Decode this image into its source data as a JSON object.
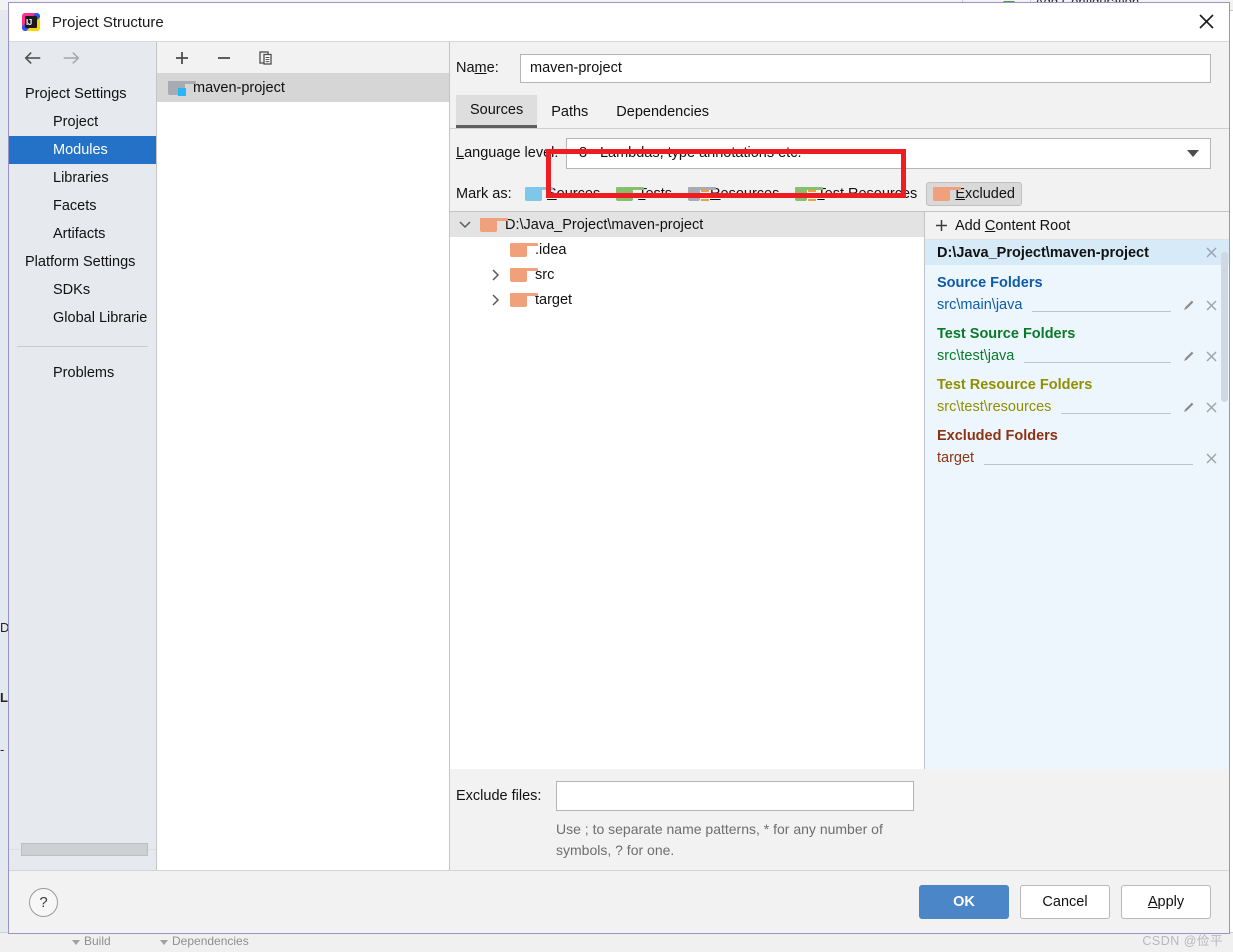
{
  "background": {
    "add_configuration": "Add Configuration...",
    "left_fragments": [
      "D",
      "L",
      "-"
    ],
    "bottom_items": [
      "Build",
      "Dependencies"
    ]
  },
  "window": {
    "title": "Project Structure",
    "app_icon": "intellij-idea-icon",
    "close_icon": "close-icon"
  },
  "sidebar": {
    "back_icon": "arrow-left-icon",
    "forward_icon": "arrow-right-icon",
    "items": [
      {
        "label": "Project Settings",
        "type": "group"
      },
      {
        "label": "Project",
        "type": "child"
      },
      {
        "label": "Modules",
        "type": "child",
        "selected": true
      },
      {
        "label": "Libraries",
        "type": "child"
      },
      {
        "label": "Facets",
        "type": "child"
      },
      {
        "label": "Artifacts",
        "type": "child"
      },
      {
        "label": "Platform Settings",
        "type": "group"
      },
      {
        "label": "SDKs",
        "type": "child"
      },
      {
        "label": "Global Librarie",
        "type": "child"
      }
    ],
    "problems_label": "Problems"
  },
  "modules_panel": {
    "toolbar": {
      "add_label": "+",
      "remove_label": "−",
      "copy_icon": "copy-icon"
    },
    "items": [
      {
        "label": "maven-project",
        "selected": true,
        "icon": "module-folder-icon"
      }
    ]
  },
  "module_editor": {
    "name_label": "Name:",
    "name_mnemonic": "m",
    "name_value": "maven-project",
    "tabs": [
      {
        "label": "Sources",
        "active": true
      },
      {
        "label": "Paths",
        "active": false
      },
      {
        "label": "Dependencies",
        "active": false
      }
    ],
    "language_level": {
      "label": "Language level:",
      "mnemonic": "L",
      "value": "8 - Lambdas, type annotations etc.",
      "dropdown_icon": "chevron-down-icon",
      "highlight_color": "#ee1d22"
    },
    "mark_as": {
      "label": "Mark as:",
      "buttons": [
        {
          "label": "Sources",
          "mnemonic": "S",
          "color": "#7ec7e8",
          "selected": false,
          "icon": "folder-sources-icon"
        },
        {
          "label": "Tests",
          "mnemonic": "T",
          "color": "#86c06c",
          "selected": false,
          "icon": "folder-tests-icon"
        },
        {
          "label": "Resources",
          "mnemonic": "R",
          "color": "#a6acb1",
          "selected": false,
          "icon": "folder-resources-icon"
        },
        {
          "label": "Test Resources",
          "mnemonic": "T",
          "color": "#86c06c",
          "selected": false,
          "icon": "folder-test-resources-icon"
        },
        {
          "label": "Excluded",
          "mnemonic": "E",
          "color": "#f0a07a",
          "selected": true,
          "icon": "folder-excluded-icon"
        }
      ]
    },
    "tree": [
      {
        "label": "D:\\Java_Project\\maven-project",
        "depth": 0,
        "expanded": true,
        "has_toggle": true,
        "selected": true
      },
      {
        "label": ".idea",
        "depth": 1,
        "has_toggle": false
      },
      {
        "label": "src",
        "depth": 1,
        "has_toggle": true,
        "expanded": false
      },
      {
        "label": "target",
        "depth": 1,
        "has_toggle": true,
        "expanded": false
      }
    ],
    "content_roots": {
      "add_label": "Add Content Root",
      "add_mnemonic": "C",
      "add_icon": "plus-icon",
      "root_path": "D:\\Java_Project\\maven-project",
      "remove_icon": "close-small-icon",
      "edit_icon": "pencil-icon",
      "sections": [
        {
          "title": "Source Folders",
          "color": "#0d5ba8",
          "entries": [
            {
              "path": "src\\main\\java",
              "editable": true
            }
          ]
        },
        {
          "title": "Test Source Folders",
          "color": "#0b7a28",
          "entries": [
            {
              "path": "src\\test\\java",
              "editable": true
            }
          ]
        },
        {
          "title": "Test Resource Folders",
          "color": "#8f8f00",
          "entries": [
            {
              "path": "src\\test\\resources",
              "editable": true
            }
          ]
        },
        {
          "title": "Excluded Folders",
          "color": "#8c3312",
          "entries": [
            {
              "path": "target",
              "editable": false
            }
          ]
        }
      ]
    },
    "exclude_files": {
      "label": "Exclude files:",
      "value": "",
      "placeholder": "",
      "hint_line1": "Use ; to separate name patterns, * for any",
      "hint_line2": "number of symbols, ? for one."
    }
  },
  "footer": {
    "help_label": "?",
    "help_icon": "help-icon",
    "buttons": [
      {
        "label": "OK",
        "style": "default"
      },
      {
        "label": "Cancel",
        "style": "normal"
      },
      {
        "label": "Apply",
        "style": "normal",
        "mnemonic": "A"
      }
    ]
  },
  "watermark": "CSDN @俭平"
}
